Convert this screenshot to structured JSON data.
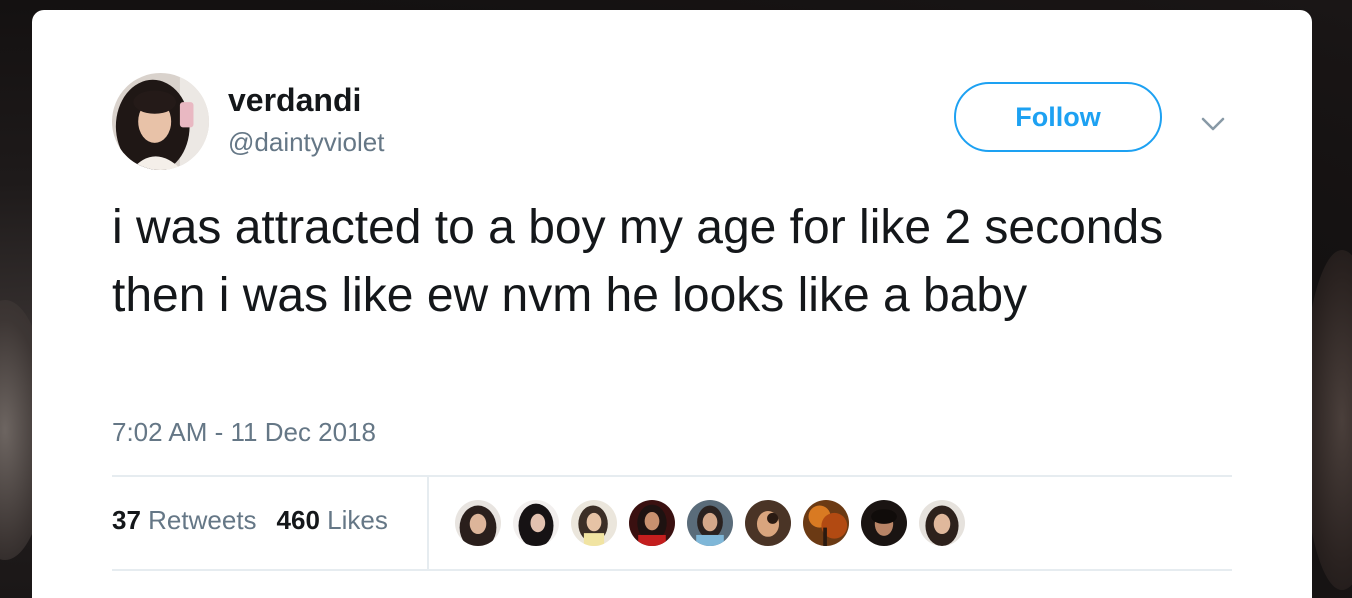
{
  "user": {
    "display_name": "verdandi",
    "handle": "@daintyviolet"
  },
  "follow_button": {
    "label": "Follow"
  },
  "tweet": {
    "text": "i was attracted to a boy my age for like 2 seconds then i was like ew nvm he looks like a baby",
    "timestamp": "7:02 AM - 11 Dec 2018"
  },
  "stats": {
    "retweets_count": "37",
    "retweets_label": "Retweets",
    "likes_count": "460",
    "likes_label": "Likes"
  },
  "icons": {
    "menu": "chevron-down-icon"
  },
  "colors": {
    "accent": "#1da1f2",
    "text_primary": "#14171a",
    "text_secondary": "#657786",
    "divider": "#e6ecf0"
  }
}
